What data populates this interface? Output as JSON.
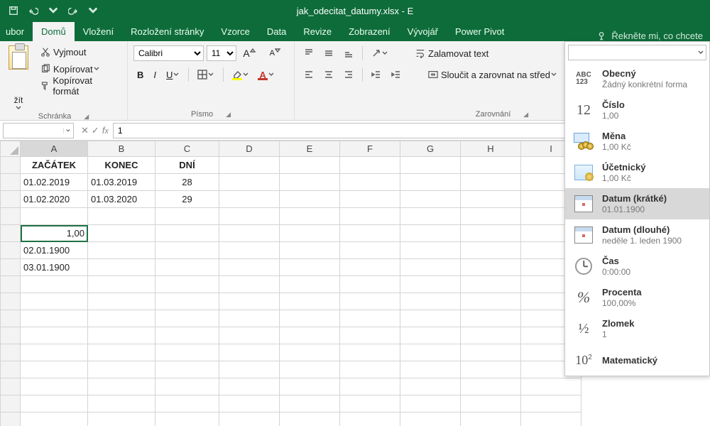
{
  "title": "jak_odecitat_datumy.xlsx - E",
  "qat": {
    "tips": [
      "save",
      "undo",
      "redo",
      "customize"
    ]
  },
  "tabs": {
    "items": [
      "ubor",
      "Domů",
      "Vložení",
      "Rozložení stránky",
      "Vzorce",
      "Data",
      "Revize",
      "Zobrazení",
      "Vývojář",
      "Power Pivot"
    ],
    "active": 1,
    "tellme": "Řekněte mi, co chcete"
  },
  "ribbon": {
    "clipboard": {
      "paste": "žít",
      "cut": "Vyjmout",
      "copy": "Kopírovat",
      "painter": "Kopírovat formát",
      "label": "Schránka"
    },
    "font": {
      "name": "Calibri",
      "size": "11",
      "label": "Písmo"
    },
    "align": {
      "wrap": "Zalamovat text",
      "merge": "Sloučit a zarovnat na střed",
      "label": "Zarovnání"
    }
  },
  "formula": {
    "namebox": "",
    "value": "1"
  },
  "columns": [
    "A",
    "B",
    "C",
    "D",
    "E",
    "F",
    "G",
    "H",
    "I"
  ],
  "cells": {
    "r1": [
      "ZAČÁTEK",
      "KONEC",
      "DNÍ",
      "",
      "",
      "",
      "",
      "",
      ""
    ],
    "r2": [
      "01.02.2019",
      "01.03.2019",
      "28",
      "",
      "",
      "",
      "",
      "",
      ""
    ],
    "r3": [
      "01.02.2020",
      "01.03.2020",
      "29",
      "",
      "",
      "",
      "",
      "",
      ""
    ],
    "r4": [
      "",
      "",
      "",
      "",
      "",
      "",
      "",
      "",
      ""
    ],
    "r5": [
      "1,00",
      "",
      "",
      "",
      "",
      "",
      "",
      "",
      ""
    ],
    "r6": [
      "02.01.1900",
      "",
      "",
      "",
      "",
      "",
      "",
      "",
      ""
    ],
    "r7": [
      "03.01.1900",
      "",
      "",
      "",
      "",
      "",
      "",
      "",
      ""
    ]
  },
  "numfmt": [
    {
      "t": "Obecný",
      "s": "Žádný konkrétní forma",
      "icon": "abc"
    },
    {
      "t": "Číslo",
      "s": "1,00",
      "icon": "12"
    },
    {
      "t": "Měna",
      "s": "1,00 Kč",
      "icon": "coins"
    },
    {
      "t": "Účetnický",
      "s": "1,00 Kč",
      "icon": "ledger"
    },
    {
      "t": "Datum (krátké)",
      "s": "01.01.1900",
      "icon": "cal",
      "sel": true
    },
    {
      "t": "Datum (dlouhé)",
      "s": "neděle 1. leden 1900",
      "icon": "cal"
    },
    {
      "t": "Čas",
      "s": "0:00:00",
      "icon": "clock"
    },
    {
      "t": "Procenta",
      "s": "100,00%",
      "icon": "pct"
    },
    {
      "t": "Zlomek",
      "s": "1",
      "icon": "frac"
    },
    {
      "t": "Matematický",
      "s": "",
      "icon": "sci"
    }
  ]
}
